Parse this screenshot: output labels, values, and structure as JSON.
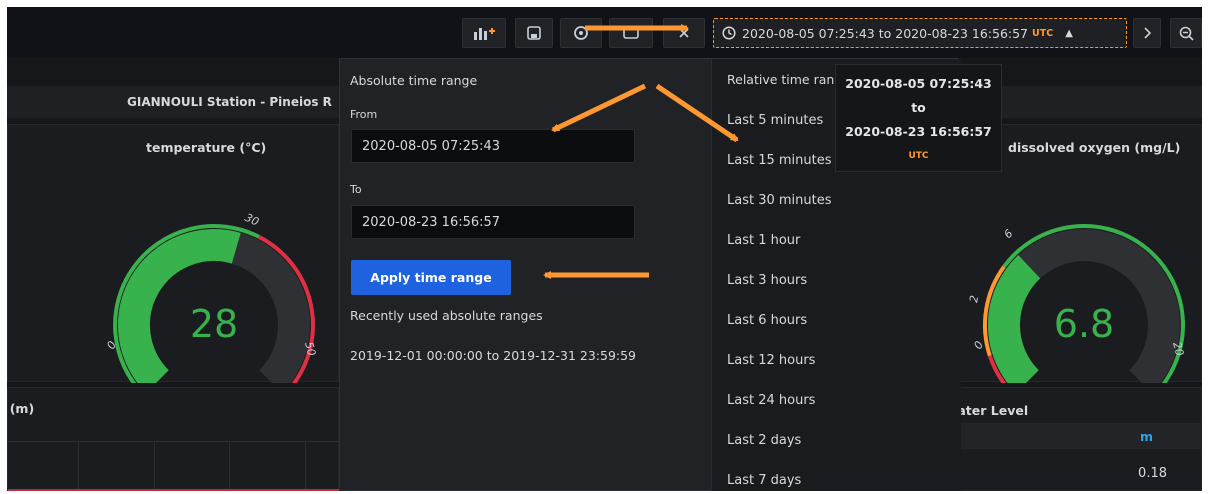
{
  "toolbar": {
    "icons": [
      "add-panel-icon",
      "save-icon",
      "settings-icon",
      "cycle-view-icon",
      "close-icon",
      "clock-icon",
      "chevron-right-icon",
      "zoom-out-icon"
    ],
    "time_range_label": "2020-08-05 07:25:43 to 2020-08-23 16:56:57",
    "timezone_label": "UTC"
  },
  "dashboard": {
    "row_title": "GIANNOULI Station - Pineios R",
    "panels": {
      "temperature": {
        "title": "temperature (°C)",
        "value": "28",
        "ticks": [
          "0",
          "30",
          "50"
        ],
        "fraction": 0.56
      },
      "oxygen": {
        "title": "dissolved oxygen (mg/L)",
        "value": "6.8",
        "ticks": [
          "0",
          "2",
          "6",
          "20"
        ],
        "fraction": 0.34
      },
      "level_left": {
        "title": "Level (m)"
      },
      "level_right": {
        "title": "Water Level",
        "column": "m",
        "value": "0.18"
      }
    }
  },
  "picker": {
    "absolute_title": "Absolute time range",
    "from_label": "From",
    "from_value": "2020-08-05 07:25:43",
    "to_label": "To",
    "to_value": "2020-08-23 16:56:57",
    "apply_label": "Apply time range",
    "recent_title": "Recently used absolute ranges",
    "recent_items": [
      "2019-12-01 00:00:00 to 2019-12-31 23:59:59"
    ],
    "relative_title": "Relative time ranges",
    "relative_items": [
      "Last 5 minutes",
      "Last 15 minutes",
      "Last 30 minutes",
      "Last 1 hour",
      "Last 3 hours",
      "Last 6 hours",
      "Last 12 hours",
      "Last 24 hours",
      "Last 2 days",
      "Last 7 days"
    ]
  },
  "tooltip": {
    "from": "2020-08-05 07:25:43",
    "separator": "to",
    "to": "2020-08-23 16:56:57",
    "timezone": "UTC"
  },
  "colors": {
    "accent_orange": "#ff9830",
    "gauge_green": "#37b24d",
    "gauge_red": "#e02f44",
    "primary_blue": "#1f62e0"
  }
}
